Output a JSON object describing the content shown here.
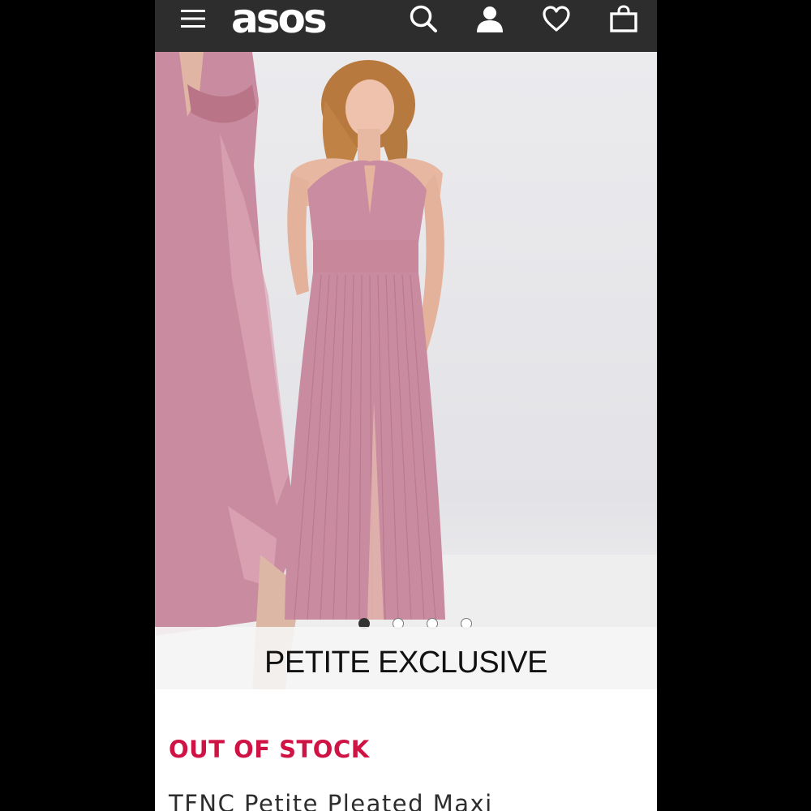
{
  "header": {
    "logo": "asos",
    "icons": {
      "menu": "hamburger-menu-icon",
      "search": "search-icon",
      "account": "account-icon",
      "saved": "heart-icon",
      "bag": "bag-icon"
    },
    "background": "#2d2d2d"
  },
  "gallery": {
    "slide_count": 4,
    "active_index": 0,
    "banner": "PETITE EXCLUSIVE",
    "dress_color": "#c98b9f"
  },
  "product": {
    "status": "OUT OF STOCK",
    "status_color": "#d01345",
    "title": "TFNC Petite Pleated Maxi"
  }
}
